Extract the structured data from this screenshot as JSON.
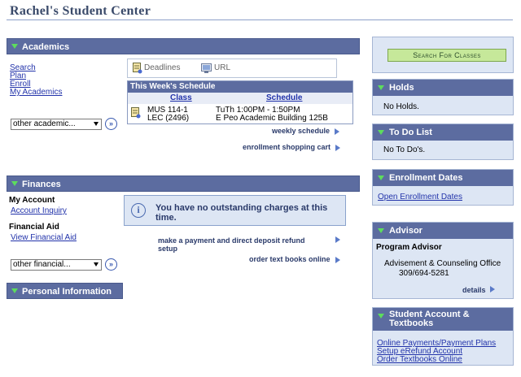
{
  "page_title": "Rachel's Student Center",
  "academics": {
    "header": "Academics",
    "links": [
      "Search",
      "Plan",
      "Enroll",
      "My Academics"
    ],
    "select_value": "other academic...",
    "tabs": {
      "deadlines": "Deadlines",
      "url": "URL"
    },
    "schedule": {
      "title": "This Week's Schedule",
      "col_class": "Class",
      "col_schedule": "Schedule",
      "row": {
        "class_line1": "MUS 114-1",
        "class_line2": "LEC (2496)",
        "sched_line1": "TuTh 1:00PM - 1:50PM",
        "sched_line2": "E Peo Academic Building 125B"
      }
    },
    "weekly_schedule": "weekly schedule",
    "shopping_cart": "enrollment shopping cart"
  },
  "finances": {
    "header": "Finances",
    "my_account": "My Account",
    "account_inquiry": "Account Inquiry",
    "financial_aid": "Financial Aid",
    "view_financial_aid": "View Financial Aid",
    "message": "You have no outstanding charges at this time.",
    "payment_link": "make a payment and direct deposit refund setup",
    "textbooks_link": "order text books online",
    "select_value": "other financial..."
  },
  "personal": {
    "header": "Personal Information"
  },
  "right": {
    "search_button": "Search For Classes",
    "holds": {
      "header": "Holds",
      "body": "No Holds."
    },
    "todo": {
      "header": "To Do List",
      "body": "No To Do's."
    },
    "enrollment": {
      "header": "Enrollment Dates",
      "link": "Open Enrollment Dates"
    },
    "advisor": {
      "header": "Advisor",
      "label": "Program Advisor",
      "office": "Advisement & Counseling Office",
      "phone": "309/694-5281",
      "details": "details"
    },
    "student_account": {
      "header": "Student Account & Textbooks",
      "links": [
        "Online Payments/Payment Plans",
        "Setup eRefund Account",
        "Order Textbooks Online"
      ]
    }
  },
  "colors": {
    "header_bg": "#5c6ca0",
    "panel_bg": "#dde6f4",
    "button_green": "#c6e89a"
  }
}
